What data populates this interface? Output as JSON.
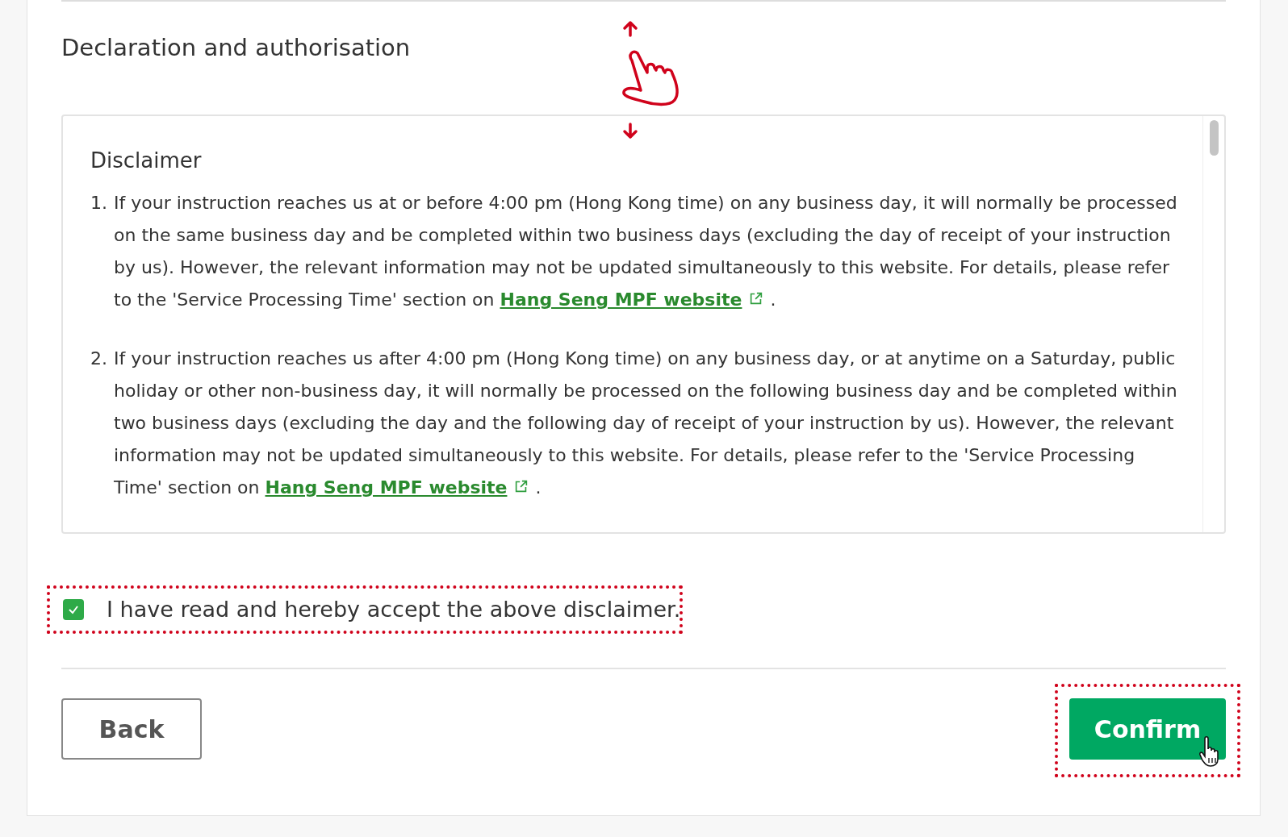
{
  "section": {
    "title": "Declaration and authorisation"
  },
  "disclaimer": {
    "title": "Disclaimer",
    "items": [
      {
        "number": "1.",
        "text": "If your instruction reaches us at or before 4:00 pm (Hong Kong time) on any business day, it will normally be processed on the same business day and be completed within two business days (excluding the day of receipt of your instruction by us). However, the relevant information may not be updated simultaneously to this website. For details, please refer to the 'Service Processing Time' section on",
        "link": "Hang Seng MPF website",
        "after": "."
      },
      {
        "number": "2.",
        "text": "If your instruction reaches us after 4:00 pm (Hong Kong time) on any business day, or at anytime on a Saturday, public holiday or other non-business day, it will normally be processed on the following business day and be completed within two business days (excluding the day and the following day of receipt of your instruction by us). However, the relevant information may not be updated simultaneously to this website. For details, please refer to the 'Service Processing Time' section on",
        "link": "Hang Seng MPF website",
        "after": "."
      }
    ]
  },
  "acceptance": {
    "label": "I have read and hereby accept the above disclaimer.",
    "checked": true
  },
  "buttons": [
    {
      "kind": "secondary",
      "label": "Back"
    },
    {
      "kind": "primary",
      "label": "Confirm"
    }
  ]
}
